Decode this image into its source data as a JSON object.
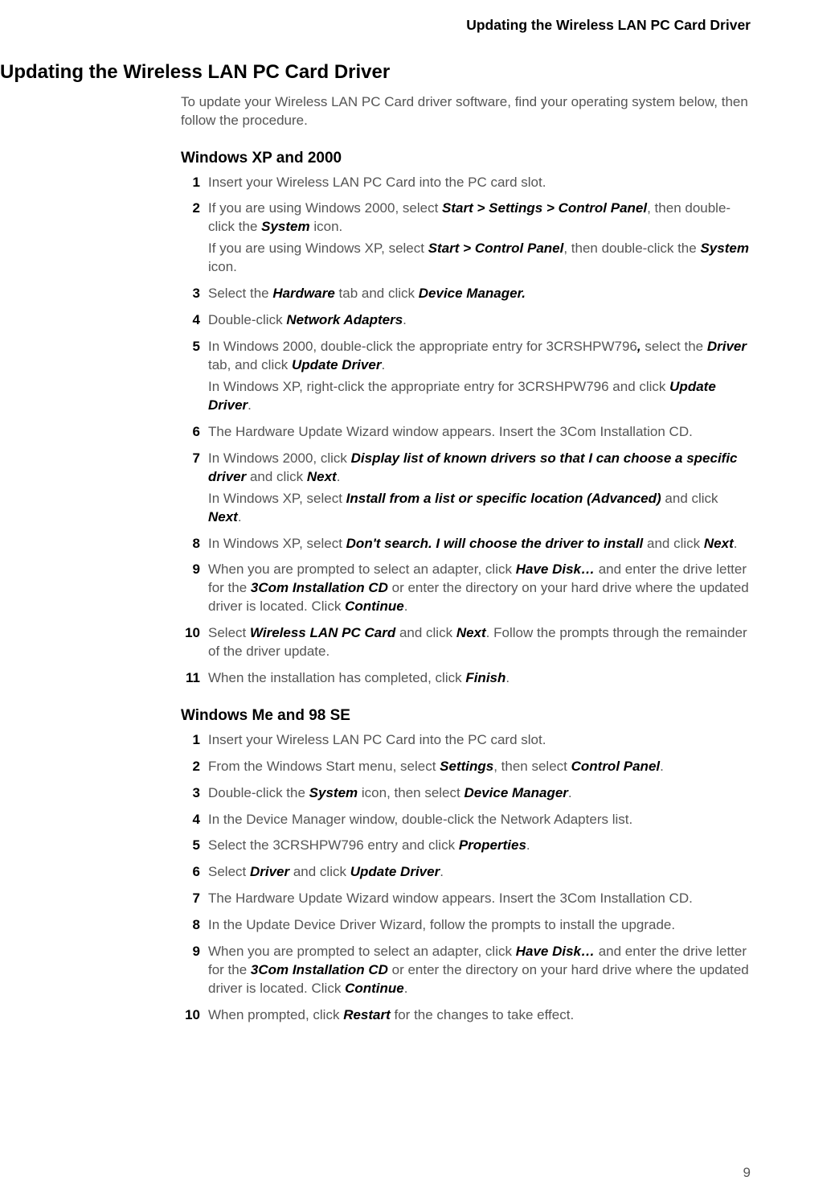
{
  "running_header": "Updating the Wireless LAN PC Card Driver",
  "title": "Updating the Wireless LAN PC Card Driver",
  "intro": "To update your Wireless LAN PC Card driver software, find your operating system below, then follow the procedure.",
  "page_number": "9",
  "sec1": {
    "heading": "Windows XP and 2000",
    "s1": {
      "n": "1",
      "t": "Insert your Wireless LAN PC Card into the PC card slot."
    },
    "s2": {
      "n": "2",
      "a": "If you are using Windows 2000, select ",
      "b": "Start > Settings > Control Panel",
      "c": ", then double-click the ",
      "d": "System",
      "e": " icon.",
      "f": "If you are using Windows XP, select ",
      "g": "Start > Control Panel",
      "h": ", then double-click the ",
      "i": "System",
      "j": " icon."
    },
    "s3": {
      "n": "3",
      "a": "Select the ",
      "b": "Hardware",
      "c": " tab and click ",
      "d": "Device Manager."
    },
    "s4": {
      "n": "4",
      "a": "Double-click ",
      "b": "Network Adapters",
      "c": "."
    },
    "s5": {
      "n": "5",
      "a": "In Windows 2000, double-click the appropriate entry for 3CRSHPW796",
      "b": ",",
      "c": " select the ",
      "d": "Driver",
      "e": " tab, and click ",
      "f": "Update Driver",
      "g": ".",
      "h": "In Windows XP, right-click the appropriate entry for 3CRSHPW796 and click ",
      "i": "Update Driver",
      "j": "."
    },
    "s6": {
      "n": "6",
      "t": "The Hardware Update Wizard window appears. Insert the 3Com Installation CD."
    },
    "s7": {
      "n": "7",
      "a": "In Windows 2000, click ",
      "b": "Display list of known drivers so that I can choose a specific driver",
      "c": " and click ",
      "d": "Next",
      "e": ".",
      "f": "In Windows XP, select ",
      "g": "Install from a list or specific location (Advanced)",
      "h": " and click ",
      "i": "Next",
      "j": "."
    },
    "s8": {
      "n": "8",
      "a": "In Windows XP, select ",
      "b": "Don't search. I will choose the driver to install",
      "c": " and click ",
      "d": "Next",
      "e": "."
    },
    "s9": {
      "n": "9",
      "a": "When you are prompted to select an adapter, click ",
      "b": "Have Disk…",
      "c": " and enter the drive letter for the ",
      "d": "3Com Installation CD",
      "e": " or enter the directory on your hard drive where the updated driver is located. Click ",
      "f": "Continue",
      "g": "."
    },
    "s10": {
      "n": "10",
      "a": "Select ",
      "b": "Wireless LAN PC Card",
      "c": " and click ",
      "d": "Next",
      "e": ". Follow the prompts through the remainder of the driver update."
    },
    "s11": {
      "n": "11",
      "a": "When the installation has completed, click ",
      "b": "Finish",
      "c": "."
    }
  },
  "sec2": {
    "heading": "Windows Me and 98 SE",
    "s1": {
      "n": "1",
      "t": "Insert your Wireless LAN PC Card into the PC card slot."
    },
    "s2": {
      "n": "2",
      "a": "From the Windows Start menu, select ",
      "b": "Settings",
      "c": ", then select ",
      "d": "Control Panel",
      "e": "."
    },
    "s3": {
      "n": "3",
      "a": "Double-click the ",
      "b": "System",
      "c": " icon, then select ",
      "d": "Device Manager",
      "e": "."
    },
    "s4": {
      "n": "4",
      "t": "In the Device Manager window, double-click the Network Adapters list."
    },
    "s5": {
      "n": "5",
      "a": "Select the 3CRSHPW796 entry and click ",
      "b": "Properties",
      "c": "."
    },
    "s6": {
      "n": "6",
      "a": "Select ",
      "b": "Driver",
      "c": " and click ",
      "d": "Update Driver",
      "e": "."
    },
    "s7": {
      "n": "7",
      "t": "The Hardware Update Wizard window appears. Insert the 3Com Installation CD."
    },
    "s8": {
      "n": "8",
      "t": "In the Update Device Driver Wizard, follow the prompts to install the upgrade."
    },
    "s9": {
      "n": "9",
      "a": "When you are prompted to select an adapter, click ",
      "b": "Have Disk…",
      "c": " and enter the drive letter for the ",
      "d": "3Com Installation CD",
      "e": " or enter the directory on your hard drive where the updated driver is located. Click ",
      "f": "Continue",
      "g": "."
    },
    "s10": {
      "n": "10",
      "a": "When prompted, click ",
      "b": "Restart",
      "c": " for the changes to take effect."
    }
  }
}
